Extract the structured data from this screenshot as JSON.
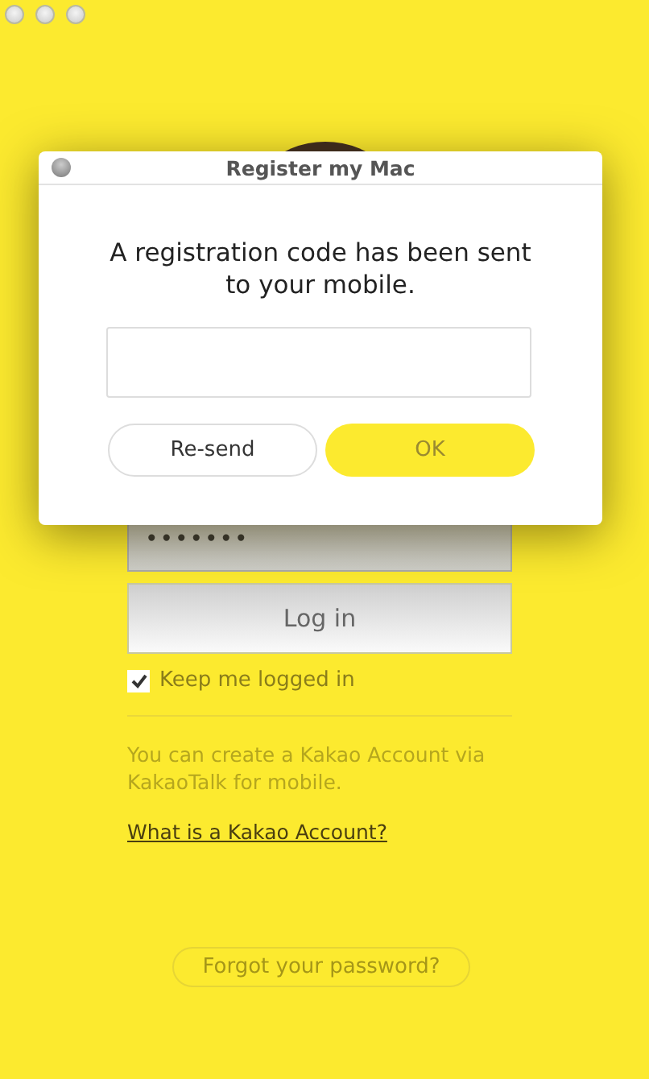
{
  "login": {
    "password_value": "•••••••",
    "login_button": "Log in",
    "keep_logged_in": {
      "label": "Keep me logged in",
      "checked": true
    },
    "info_text": "You can create a Kakao Account via KakaoTalk for mobile.",
    "account_link": "What is a Kakao Account?",
    "forgot_button": "Forgot your password?"
  },
  "dialog": {
    "title": "Register my Mac",
    "message": "A registration code has been sent to your mobile.",
    "buttons": [
      {
        "label": "Re-send",
        "kind": "secondary"
      },
      {
        "label": "OK",
        "kind": "primary"
      }
    ]
  }
}
